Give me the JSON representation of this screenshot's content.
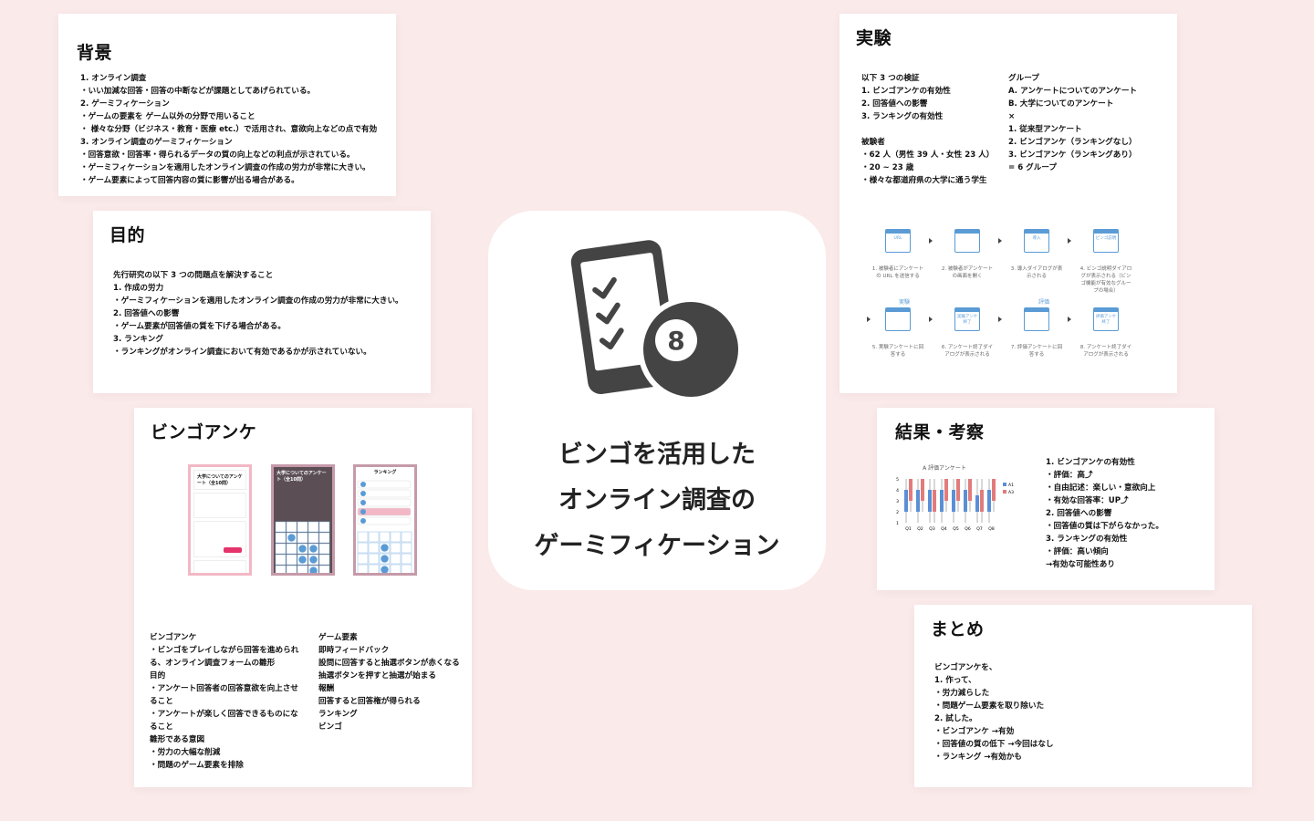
{
  "background": {
    "title": "背景",
    "lines": [
      "1. オンライン調査",
      "・いい加減な回答・回答の中断などが課題としてあげられている。",
      "2. ゲーミフィケーション",
      "・ゲームの要素を ゲーム以外の分野で用いること",
      "・ 様々な分野（ビジネス・教育・医療 etc.）で活用され、意欲向上などの点で有効",
      "3. オンライン調査のゲーミフィケーション",
      "・回答意欲・回答率・得られるデータの質の向上などの利点が示されている。",
      "・ゲーミフィケーションを適用したオンライン調査の作成の労力が非常に大きい。",
      "・ゲーム要素によって回答内容の質に影響が出る場合がある。"
    ]
  },
  "purpose": {
    "title": "目的",
    "lines": [
      "先行研究の以下 3 つの問題点を解決すること",
      "1. 作成の労力",
      "・ゲーミフィケーションを適用したオンライン調査の作成の労力が非常に大きい。",
      "2. 回答値への影響",
      "・ゲーム要素が回答値の質を下げる場合がある。",
      "3. ランキング",
      "・ランキングがオンライン調査において有効であるかが示されていない。"
    ]
  },
  "bingo": {
    "title": "ビンゴアンケ",
    "phone1_title": "大学についてのアンケート（全10問）",
    "phone2_title": "大学についてのアンケート（全10問）",
    "phone3_title": "ランキング",
    "left_lines": [
      "ビンゴアンケ",
      "・ビンゴをプレイしながら回答を進められ",
      "る、オンライン調査フォームの雛形",
      "目的",
      "・アンケート回答者の回答意欲を向上させ",
      "ること",
      "・アンケートが楽しく回答できるものにな",
      "ること",
      "雛形である意図",
      "・労力の大幅な削減",
      "・問題のゲーム要素を排除"
    ],
    "right_lines": [
      "ゲーム要素",
      "即時フィードバック",
      "設問に回答すると抽選ボタンが赤くなる",
      "抽選ボタンを押すと抽選が始まる",
      "報酬",
      "回答すると回答権が得られる",
      "ランキング",
      "ビンゴ"
    ]
  },
  "center": {
    "title_lines": [
      "ビンゴを活用した",
      "オンライン調査の",
      "ゲーミフィケーション"
    ],
    "ball_number": "8"
  },
  "experiment": {
    "title": "実験",
    "left_lines": [
      "以下 3 つの検証",
      "1. ビンゴアンケの有効性",
      "2. 回答値への影響",
      "3. ランキングの有効性",
      "",
      "被験者",
      "・62 人（男性 39 人・女性 23 人）",
      "・20 ~ 23 歳",
      "・様々な都道府県の大学に通う学生"
    ],
    "right_lines": [
      "グループ",
      "A. アンケートについてのアンケート",
      "B. 大学についてのアンケート",
      "×",
      "1. 従来型アンケート",
      "2. ビンゴアンケ（ランキングなし）",
      "3. ビンゴアンケ（ランキングあり）",
      "= 6 グループ"
    ],
    "flow_row1": [
      {
        "caption": "1. 被験者にアンケートの URL を送信する",
        "icon_text": "URL"
      },
      {
        "caption": "2. 被験者がアンケートの画面を開く",
        "icon_text": ""
      },
      {
        "caption": "3. 導入ダイアログが表示される",
        "icon_text": "導入"
      },
      {
        "caption": "4. ビンゴ説明ダイアログが表示される（ビンゴ機能が有効なグループの場合）",
        "icon_text": "ビンゴ説明"
      }
    ],
    "flow_row2": [
      {
        "caption": "5. 実験アンケートに回答する",
        "icon_text": ""
      },
      {
        "caption": "6. アンケート終了ダイアログが表示される",
        "icon_text": "実験アンケ終了"
      },
      {
        "caption": "7. 評価アンケートに回答する",
        "icon_text": ""
      },
      {
        "caption": "8. アンケート終了ダイアログが表示される",
        "icon_text": "評価アンケ終了"
      }
    ],
    "flow_label_exp": "実験",
    "flow_label_eval": "評価"
  },
  "result": {
    "title": "結果・考察",
    "lines": [
      "1. ビンゴアンケの有効性",
      "・評価：高⤴",
      "・自由記述：楽しい・意欲向上",
      "・有効な回答率：UP⤴",
      "2. 回答値への影響",
      "・回答値の質は下がらなかった。",
      "3. ランキングの有効性",
      "・評価：高い傾向",
      "→有効な可能性あり"
    ]
  },
  "summary": {
    "title": "まとめ",
    "lines": [
      "ビンゴアンケを、",
      "1. 作って、",
      "・労力減らした",
      "・問題ゲーム要素を取り除いた",
      "2. 試した。",
      "・ビンゴアンケ →有効",
      "・回答値の質の低下 →今回はなし",
      "・ランキング →有効かも"
    ]
  },
  "chart_data": {
    "type": "box",
    "title": "A 評価アンケート",
    "categories": [
      "Q1",
      "Q2",
      "Q3",
      "Q4",
      "Q5",
      "Q6",
      "Q7",
      "Q8"
    ],
    "series": [
      {
        "name": "A1",
        "color": "#5b8fd6",
        "boxes": [
          [
            1,
            2,
            3,
            4,
            5
          ],
          [
            1,
            2,
            3,
            4,
            5
          ],
          [
            1,
            2,
            2.5,
            4,
            5
          ],
          [
            1,
            2,
            3,
            4,
            5
          ],
          [
            1,
            2,
            3,
            4,
            5
          ],
          [
            1,
            2,
            3,
            4,
            5
          ],
          [
            1,
            2,
            2.5,
            3.5,
            5
          ],
          [
            1,
            2,
            3,
            4,
            5
          ]
        ]
      },
      {
        "name": "A3",
        "color": "#e27b7b",
        "boxes": [
          [
            2,
            3,
            4,
            5,
            5
          ],
          [
            2,
            3,
            4,
            5,
            5
          ],
          [
            1,
            2,
            3,
            4,
            5
          ],
          [
            2,
            3,
            4,
            5,
            5
          ],
          [
            2,
            3,
            4,
            5,
            5
          ],
          [
            2,
            3,
            4,
            5,
            5
          ],
          [
            1,
            2,
            3,
            4,
            5
          ],
          [
            2,
            3,
            4,
            5,
            5
          ]
        ]
      }
    ],
    "ylim": [
      1,
      5
    ],
    "yticks": [
      "1",
      "2",
      "3",
      "4",
      "5"
    ]
  },
  "colors": {
    "page_bg": "#fbeaea",
    "pink": "#f3b7c6",
    "blue": "#5a9bd5",
    "icon_dark": "#444444"
  }
}
